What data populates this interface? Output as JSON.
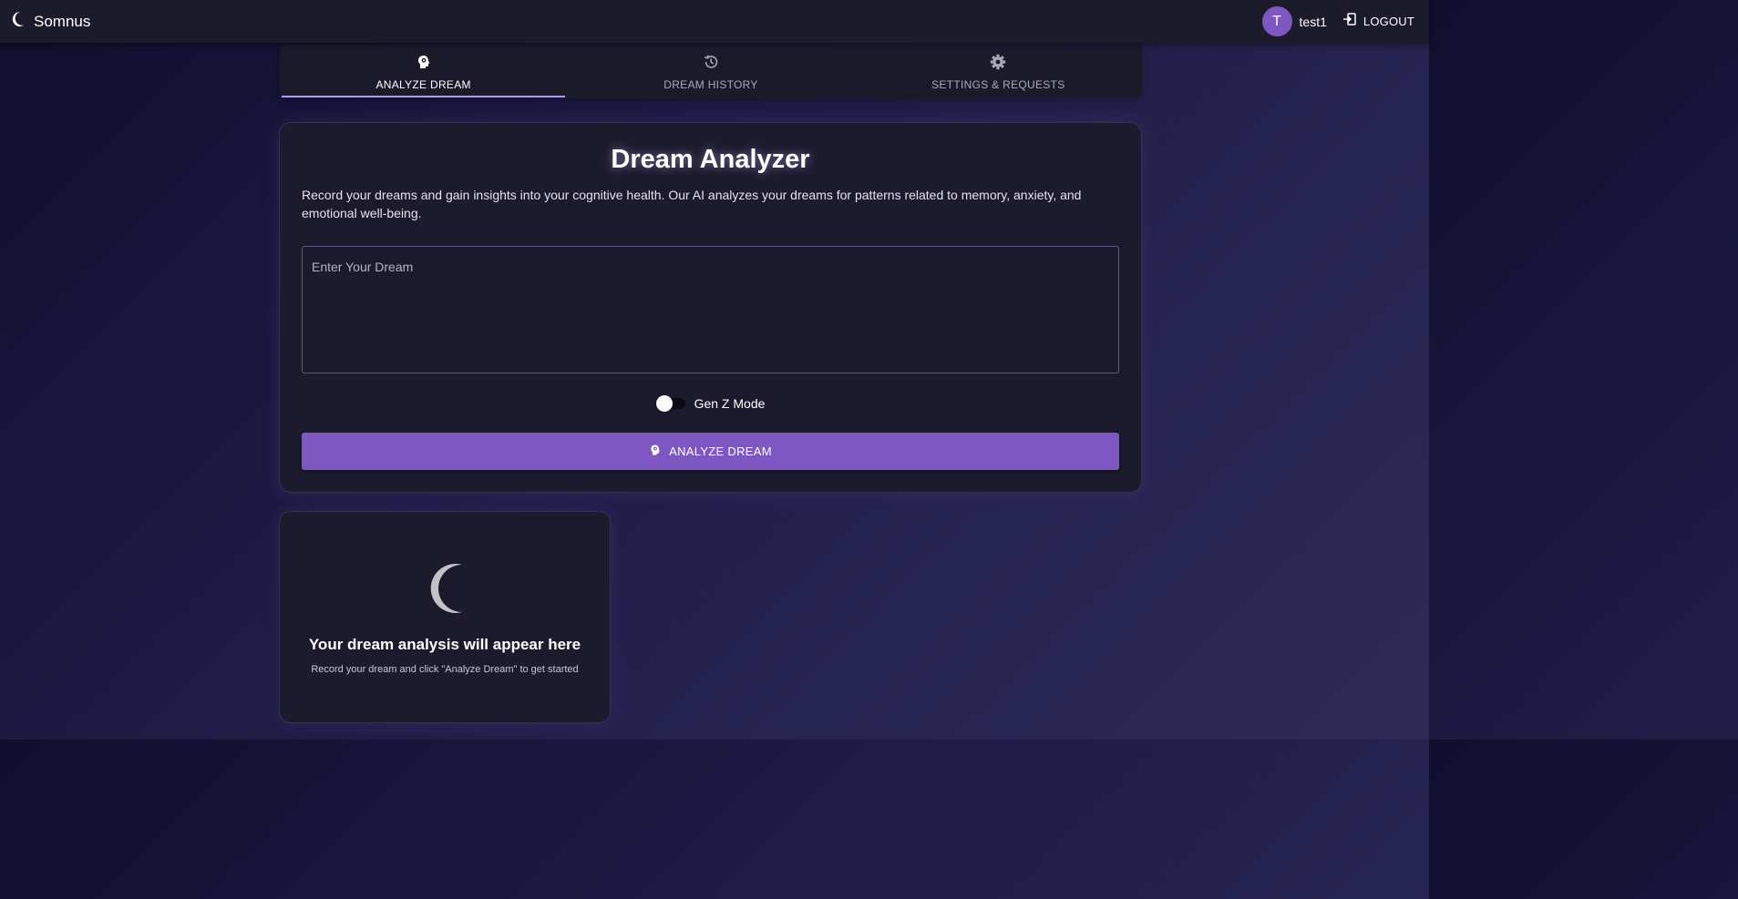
{
  "app": {
    "name": "Somnus"
  },
  "user": {
    "avatar_initial": "T",
    "username": "test1",
    "logout_label": "LOGOUT"
  },
  "tabs": [
    {
      "label": "ANALYZE DREAM",
      "icon": "brain-head-icon",
      "active": true
    },
    {
      "label": "DREAM HISTORY",
      "icon": "history-icon",
      "active": false
    },
    {
      "label": "SETTINGS & REQUESTS",
      "icon": "gear-icon",
      "active": false
    }
  ],
  "analyzer": {
    "title": "Dream Analyzer",
    "description": "Record your dreams and gain insights into your cognitive health. Our AI analyzes your dreams for patterns related to memory, anxiety, and emotional well-being.",
    "input_placeholder": "Enter Your Dream",
    "input_value": "",
    "toggle_label": "Gen Z Mode",
    "toggle_on": false,
    "button_label": "ANALYZE DREAM"
  },
  "result": {
    "title": "Your dream analysis will appear here",
    "subtitle": "Record your dream and click \"Analyze Dream\" to get started"
  },
  "colors": {
    "accent": "#7e57c2",
    "tab_indicator": "#b794f6",
    "appbar": "#1c1b2c",
    "card": "#1c1b2e"
  }
}
